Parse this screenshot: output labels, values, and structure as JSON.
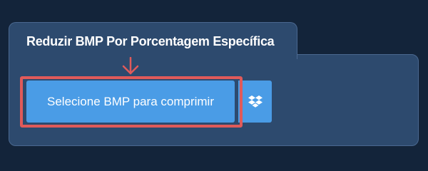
{
  "tab": {
    "title": "Reduzir BMP Por Porcentagem Específica"
  },
  "upload": {
    "button_label": "Selecione BMP para comprimir"
  },
  "icons": {
    "arrow": "arrow-down-icon",
    "dropbox": "dropbox-icon"
  },
  "colors": {
    "page_background": "#13243a",
    "panel_background": "#2d4a6e",
    "button_background": "#4a9ce6",
    "highlight": "#e05a5a"
  }
}
